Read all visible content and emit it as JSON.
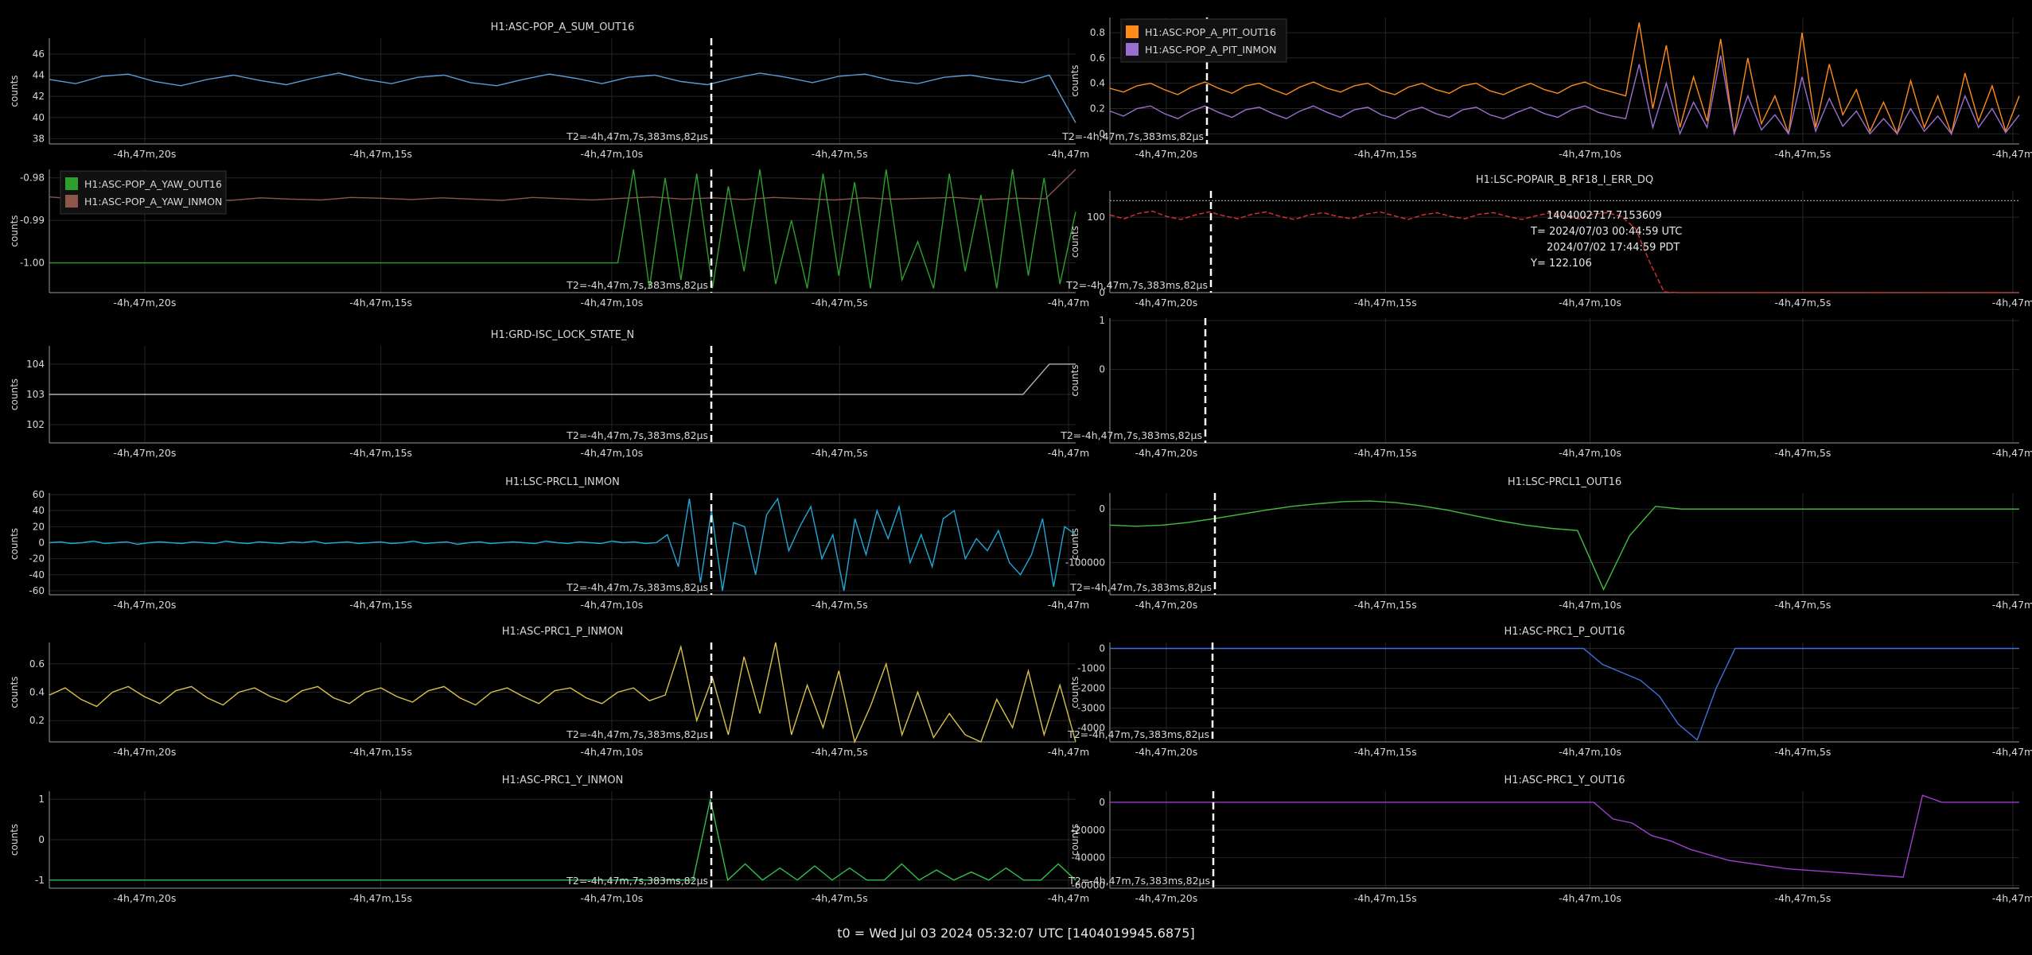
{
  "footer": "t0 = Wed Jul 03 2024 05:32:07 UTC [1404019945.6875]",
  "colors": {
    "background": "#000000",
    "axis": "#9a9a9a",
    "grid": "#262626",
    "text": "#d8d8d8",
    "marker": "#ffffff"
  },
  "chart_data": [
    {
      "type": "line",
      "title": "H1:ASC-POP_A_SUM_OUT16",
      "ylabel": "counts",
      "x_tick_labels": [
        "-4h,47m,20s",
        "-4h,47m,15s",
        "-4h,47m,10s",
        "-4h,47m,5s",
        "-4h,47m"
      ],
      "ylim": [
        37.5,
        47.5
      ],
      "yticks": [
        38,
        40,
        42,
        44,
        46
      ],
      "marker_label": "T2=-4h,47m,7s,383ms,82µs",
      "series": [
        {
          "color": "#5b9bd5",
          "values": [
            43.6,
            43.2,
            43.9,
            44.1,
            43.4,
            43.0,
            43.6,
            44.0,
            43.5,
            43.1,
            43.7,
            44.2,
            43.6,
            43.2,
            43.8,
            44.0,
            43.3,
            43.0,
            43.6,
            44.1,
            43.7,
            43.2,
            43.8,
            44.0,
            43.4,
            43.1,
            43.7,
            44.2,
            43.8,
            43.3,
            43.9,
            44.1,
            43.5,
            43.2,
            43.8,
            44.0,
            43.6,
            43.3,
            44.0,
            39.5
          ]
        }
      ]
    },
    {
      "type": "line",
      "title": "",
      "ylabel": "counts",
      "x_tick_labels": [
        "-4h,47m,20s",
        "-4h,47m,15s",
        "-4h,47m,10s",
        "-4h,47m,5s",
        "-4h,47m"
      ],
      "ylim": [
        -0.08,
        0.92
      ],
      "yticks": [
        0,
        0.2,
        0.4,
        0.6,
        0.8
      ],
      "marker_label": "T2=-4h,47m,7s,383ms,82µs",
      "legend": [
        {
          "label": "H1:ASC-POP_A_PIT_OUT16",
          "color": "#ff8c1a"
        },
        {
          "label": "H1:ASC-POP_A_PIT_INMON",
          "color": "#9b6fd0"
        }
      ],
      "series": [
        {
          "color": "#ff8c1a",
          "values": [
            0.36,
            0.33,
            0.38,
            0.4,
            0.35,
            0.31,
            0.37,
            0.41,
            0.36,
            0.32,
            0.38,
            0.4,
            0.35,
            0.31,
            0.37,
            0.41,
            0.36,
            0.33,
            0.38,
            0.4,
            0.34,
            0.31,
            0.37,
            0.4,
            0.35,
            0.32,
            0.38,
            0.4,
            0.34,
            0.31,
            0.36,
            0.4,
            0.35,
            0.32,
            0.38,
            0.41,
            0.36,
            0.33,
            0.3,
            0.88,
            0.2,
            0.7,
            0.05,
            0.45,
            0.1,
            0.75,
            0.0,
            0.6,
            0.08,
            0.3,
            0.0,
            0.8,
            0.05,
            0.55,
            0.15,
            0.35,
            0.02,
            0.25,
            0.0,
            0.42,
            0.05,
            0.3,
            0.0,
            0.48,
            0.1,
            0.38,
            0.02,
            0.3
          ]
        },
        {
          "color": "#9b6fd0",
          "values": [
            0.18,
            0.14,
            0.2,
            0.22,
            0.16,
            0.12,
            0.18,
            0.22,
            0.17,
            0.13,
            0.19,
            0.21,
            0.16,
            0.12,
            0.18,
            0.22,
            0.17,
            0.13,
            0.19,
            0.21,
            0.15,
            0.12,
            0.18,
            0.21,
            0.16,
            0.13,
            0.19,
            0.21,
            0.15,
            0.12,
            0.17,
            0.21,
            0.16,
            0.13,
            0.19,
            0.22,
            0.17,
            0.14,
            0.12,
            0.55,
            0.05,
            0.4,
            0.0,
            0.25,
            0.05,
            0.62,
            0.0,
            0.3,
            0.03,
            0.15,
            0.0,
            0.45,
            0.02,
            0.28,
            0.06,
            0.18,
            0.0,
            0.12,
            0.0,
            0.2,
            0.02,
            0.14,
            0.0,
            0.3,
            0.05,
            0.2,
            0.01,
            0.15
          ]
        }
      ]
    },
    {
      "type": "line",
      "title": "",
      "ylabel": "counts",
      "x_tick_labels": [
        "-4h,47m,20s",
        "-4h,47m,15s",
        "-4h,47m,10s",
        "-4h,47m,5s",
        "-4h,47m"
      ],
      "ylim": [
        -1.007,
        -0.978
      ],
      "yticks": [
        -1.0,
        -0.99,
        -0.98
      ],
      "ytick_labels": [
        "-1.00",
        "-0.99",
        "-0.98"
      ],
      "marker_label": "T2=-4h,47m,7s,383ms,82µs",
      "legend": [
        {
          "label": "H1:ASC-POP_A_YAW_OUT16",
          "color": "#2ca02c"
        },
        {
          "label": "H1:ASC-POP_A_YAW_INMON",
          "color": "#8c564b"
        }
      ],
      "series": [
        {
          "color": "#8c564b",
          "values": [
            -0.9845,
            -0.985,
            -0.9848,
            -0.9852,
            -0.9846,
            -0.9849,
            -0.9853,
            -0.9847,
            -0.985,
            -0.9852,
            -0.9846,
            -0.9848,
            -0.9851,
            -0.9847,
            -0.985,
            -0.9853,
            -0.9846,
            -0.9849,
            -0.9852,
            -0.9848,
            -0.9845,
            -0.985,
            -0.9847,
            -0.9851,
            -0.9846,
            -0.9849,
            -0.9852,
            -0.9847,
            -0.985,
            -0.9848,
            -0.9846,
            -0.9851,
            -0.9848,
            -0.9849,
            -0.978
          ]
        },
        {
          "color": "#2ca02c",
          "values": [
            -1.0,
            -1.0,
            -1.0,
            -1.0,
            -1.0,
            -1.0,
            -1.0,
            -1.0,
            -1.0,
            -1.0,
            -1.0,
            -1.0,
            -1.0,
            -1.0,
            -1.0,
            -1.0,
            -1.0,
            -1.0,
            -1.0,
            -1.0,
            -1.0,
            -1.0,
            -1.0,
            -1.0,
            -1.0,
            -1.0,
            -1.0,
            -1.0,
            -1.0,
            -1.0,
            -1.0,
            -1.0,
            -1.0,
            -1.0,
            -1.0,
            -1.0,
            -1.0,
            -0.978,
            -1.006,
            -0.98,
            -1.004,
            -0.979,
            -1.006,
            -0.982,
            -1.002,
            -0.978,
            -1.005,
            -0.99,
            -1.006,
            -0.979,
            -1.003,
            -0.981,
            -1.006,
            -0.978,
            -1.004,
            -0.995,
            -1.006,
            -0.979,
            -1.002,
            -0.984,
            -1.006,
            -0.978,
            -1.003,
            -0.98,
            -1.005,
            -0.988
          ]
        }
      ]
    },
    {
      "type": "line",
      "title": "H1:LSC-POPAIR_B_RF18_I_ERR_DQ",
      "ylabel": "counts",
      "x_tick_labels": [
        "-4h,47m,20s",
        "-4h,47m,15s",
        "-4h,47m,10s",
        "-4h,47m,5s",
        "-4h,47m"
      ],
      "ylim": [
        0,
        135
      ],
      "yticks": [
        0,
        100
      ],
      "marker_label": "T2=-4h,47m,7s,383ms,82µs",
      "hline": 122.106,
      "tooltip": [
        "1404002717.7153609",
        "T= 2024/07/03 00:44:59 UTC",
        "2024/07/02 17:44:59 PDT",
        "Y= 122.106"
      ],
      "series": [
        {
          "color": "#e03030",
          "values": [
            103,
            98,
            105,
            108,
            101,
            97,
            103,
            107,
            102,
            98,
            104,
            107,
            101,
            97,
            103,
            106,
            101,
            98,
            104,
            107,
            102,
            97,
            103,
            106,
            101,
            98,
            104,
            106,
            101,
            97,
            102,
            106,
            101,
            98,
            104,
            106,
            101,
            85,
            40,
            1,
            0,
            0,
            0,
            0,
            0,
            0,
            0,
            0,
            0,
            0,
            0,
            0,
            0,
            0,
            0,
            0,
            0,
            0,
            0,
            0,
            0,
            0,
            0,
            0,
            0
          ]
        }
      ]
    },
    {
      "type": "line",
      "title": "H1:GRD-ISC_LOCK_STATE_N",
      "ylabel": "counts",
      "x_tick_labels": [
        "-4h,47m,20s",
        "-4h,47m,15s",
        "-4h,47m,10s",
        "-4h,47m,5s",
        "-4h,47m"
      ],
      "ylim": [
        101.4,
        104.6
      ],
      "yticks": [
        102,
        103,
        104
      ],
      "marker_label": "T2=-4h,47m,7s,383ms,82µs",
      "series": [
        {
          "color": "#b0b0b0",
          "values": [
            103,
            103,
            103,
            103,
            103,
            103,
            103,
            103,
            103,
            103,
            103,
            103,
            103,
            103,
            103,
            103,
            103,
            103,
            103,
            103,
            103,
            103,
            103,
            103,
            103,
            103,
            103,
            103,
            103,
            103,
            103,
            103,
            103,
            103,
            103,
            103,
            103,
            103,
            104,
            104
          ]
        }
      ]
    },
    {
      "type": "line",
      "title": "",
      "ylabel": "counts",
      "x_tick_labels": [
        "-4h,47m,20s",
        "-4h,47m,15s",
        "-4h,47m,10s",
        "-4h,47m,5s",
        "-4h,47m"
      ],
      "ylim": [
        -1.5,
        1.05
      ],
      "yticks": [
        0,
        1
      ],
      "marker_label": "T2=-4h,47m,7s,383ms,82µs",
      "series": []
    },
    {
      "type": "line",
      "title": "H1:LSC-PRCL1_INMON",
      "ylabel": "counts",
      "x_tick_labels": [
        "-4h,47m,20s",
        "-4h,47m,15s",
        "-4h,47m,10s",
        "-4h,47m,5s",
        "-4h,47m"
      ],
      "ylim": [
        -65,
        62
      ],
      "yticks": [
        -60,
        -40,
        -20,
        0,
        20,
        40,
        60
      ],
      "marker_label": "T2=-4h,47m,7s,383ms,82µs",
      "series": [
        {
          "color": "#1fa8d8",
          "values": [
            0,
            1,
            -1,
            0,
            2,
            -1,
            0,
            1,
            -2,
            0,
            1,
            0,
            -1,
            1,
            0,
            -1,
            2,
            0,
            -1,
            1,
            0,
            -1,
            1,
            0,
            2,
            -1,
            0,
            1,
            -1,
            0,
            1,
            -1,
            0,
            2,
            -1,
            0,
            1,
            -2,
            0,
            1,
            -1,
            0,
            1,
            0,
            -1,
            2,
            0,
            -1,
            1,
            0,
            -1,
            2,
            0,
            1,
            -1,
            0,
            10,
            -30,
            55,
            -50,
            40,
            -60,
            25,
            20,
            -40,
            35,
            55,
            -10,
            20,
            45,
            -20,
            10,
            -60,
            30,
            -15,
            40,
            5,
            45,
            -25,
            10,
            -30,
            30,
            40,
            -20,
            5,
            -10,
            15,
            -25,
            -40,
            -15,
            30,
            -55,
            20,
            10
          ]
        }
      ]
    },
    {
      "type": "line",
      "title": "H1:LSC-PRCL1_OUT16",
      "ylabel": "counts",
      "x_tick_labels": [
        "-4h,47m,20s",
        "-4h,47m,15s",
        "-4h,47m,10s",
        "-4h,47m,5s",
        "-4h,47m"
      ],
      "ylim": [
        -160000,
        30000
      ],
      "yticks": [
        -100000,
        0
      ],
      "marker_label": "T2=-4h,47m,7s,383ms,82µs",
      "series": [
        {
          "color": "#3fbf3f",
          "values": [
            -30000,
            -32000,
            -30000,
            -25000,
            -18000,
            -10000,
            -2000,
            5000,
            10000,
            14000,
            15000,
            12000,
            6000,
            -2000,
            -12000,
            -22000,
            -30000,
            -36000,
            -40000,
            -150000,
            -50000,
            5000,
            0,
            0,
            0,
            0,
            0,
            0,
            0,
            0,
            0,
            0,
            0,
            0,
            0,
            0
          ]
        }
      ]
    },
    {
      "type": "line",
      "title": "H1:ASC-PRC1_P_INMON",
      "ylabel": "counts",
      "x_tick_labels": [
        "-4h,47m,20s",
        "-4h,47m,15s",
        "-4h,47m,10s",
        "-4h,47m,5s",
        "-4h,47m"
      ],
      "ylim": [
        0.05,
        0.75
      ],
      "yticks": [
        0.2,
        0.4,
        0.6
      ],
      "marker_label": "T2=-4h,47m,7s,383ms,82µs",
      "series": [
        {
          "color": "#d9c24a",
          "values": [
            0.38,
            0.43,
            0.35,
            0.3,
            0.4,
            0.44,
            0.37,
            0.32,
            0.41,
            0.44,
            0.36,
            0.31,
            0.4,
            0.43,
            0.37,
            0.33,
            0.41,
            0.44,
            0.36,
            0.32,
            0.4,
            0.43,
            0.37,
            0.33,
            0.41,
            0.44,
            0.36,
            0.31,
            0.4,
            0.43,
            0.37,
            0.32,
            0.41,
            0.43,
            0.36,
            0.32,
            0.4,
            0.43,
            0.34,
            0.38,
            0.72,
            0.2,
            0.5,
            0.1,
            0.65,
            0.25,
            0.75,
            0.1,
            0.45,
            0.15,
            0.55,
            0.05,
            0.3,
            0.6,
            0.1,
            0.4,
            0.08,
            0.25,
            0.1,
            0.05,
            0.35,
            0.15,
            0.55,
            0.1,
            0.45,
            0.05
          ]
        }
      ]
    },
    {
      "type": "line",
      "title": "H1:ASC-PRC1_P_OUT16",
      "ylabel": "counts",
      "x_tick_labels": [
        "-4h,47m,20s",
        "-4h,47m,15s",
        "-4h,47m,10s",
        "-4h,47m,5s",
        "-4h,47m"
      ],
      "ylim": [
        -4700,
        300
      ],
      "yticks": [
        -4000,
        -3000,
        -2000,
        -1000,
        0
      ],
      "marker_label": "T2=-4h,47m,7s,383ms,82µs",
      "series": [
        {
          "color": "#3f6fe0",
          "values": [
            0,
            0,
            0,
            0,
            0,
            0,
            0,
            0,
            0,
            0,
            0,
            0,
            0,
            0,
            0,
            0,
            0,
            0,
            0,
            0,
            0,
            0,
            0,
            0,
            0,
            0,
            -800,
            -1200,
            -1600,
            -2400,
            -3800,
            -4600,
            -2000,
            0,
            0,
            0,
            0,
            0,
            0,
            0,
            0,
            0,
            0,
            0,
            0,
            0,
            0,
            0,
            0
          ]
        }
      ]
    },
    {
      "type": "line",
      "title": "H1:ASC-PRC1_Y_INMON",
      "ylabel": "counts",
      "x_tick_labels": [
        "-4h,47m,20s",
        "-4h,47m,15s",
        "-4h,47m,10s",
        "-4h,47m,5s",
        "-4h,47m"
      ],
      "ylim": [
        -1.2,
        1.2
      ],
      "yticks": [
        -1,
        0,
        1
      ],
      "marker_label": "T2=-4h,47m,7s,383ms,82µs",
      "series": [
        {
          "color": "#2fbf4f",
          "values": [
            -1,
            -1,
            -1,
            -1,
            -1,
            -1,
            -1,
            -1,
            -1,
            -1,
            -1,
            -1,
            -1,
            -1,
            -1,
            -1,
            -1,
            -1,
            -1,
            -1,
            -1,
            -1,
            -1,
            -1,
            -1,
            -1,
            -1,
            -1,
            -1,
            -1,
            -1,
            -1,
            -1,
            -1,
            -1,
            -1,
            -1,
            -1,
            1,
            -1,
            -0.6,
            -1,
            -0.7,
            -1,
            -0.65,
            -1,
            -0.7,
            -1,
            -1,
            -0.6,
            -1,
            -0.75,
            -1,
            -0.8,
            -1,
            -0.7,
            -1,
            -1,
            -0.6,
            -1
          ]
        }
      ]
    },
    {
      "type": "line",
      "title": "H1:ASC-PRC1_Y_OUT16",
      "ylabel": "counts",
      "x_tick_labels": [
        "-4h,47m,20s",
        "-4h,47m,15s",
        "-4h,47m,10s",
        "-4h,47m,5s",
        "-4h,47m"
      ],
      "ylim": [
        -62000,
        8000
      ],
      "yticks": [
        -60000,
        -40000,
        -20000,
        0
      ],
      "marker_label": "T2=-4h,47m,7s,383ms,82µs",
      "series": [
        {
          "color": "#9d3fd0",
          "values": [
            0,
            0,
            0,
            0,
            0,
            0,
            0,
            0,
            0,
            0,
            0,
            0,
            0,
            0,
            0,
            0,
            0,
            0,
            0,
            0,
            0,
            0,
            0,
            0,
            0,
            0,
            -12000,
            -15000,
            -24000,
            -28000,
            -34000,
            -38000,
            -42000,
            -44000,
            -46000,
            -48000,
            -49000,
            -50000,
            -51000,
            -52000,
            -53000,
            -54000,
            5000,
            0,
            0,
            0,
            0,
            0
          ]
        }
      ]
    }
  ]
}
